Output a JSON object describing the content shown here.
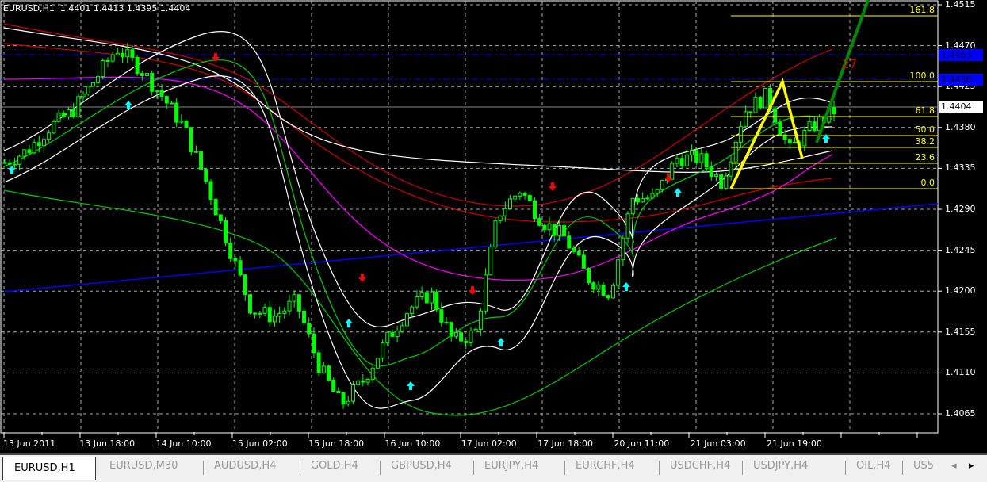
{
  "header": {
    "symbol": "EURUSD,H1",
    "ohlc": "1.4401 1.4413 1.4395 1.4404"
  },
  "price_axis": [
    "1.4515",
    "1.4470",
    "1.4425",
    "1.4380",
    "1.4335",
    "1.4290",
    "1.4245",
    "1.4200",
    "1.4155",
    "1.4110",
    "1.4065"
  ],
  "price_boxes": {
    "line1": "1.4463",
    "line2": "1.4436",
    "current": "1.4404"
  },
  "fib_levels": [
    "161.8",
    "100.0",
    "61.8",
    "50.0",
    "38.2",
    "23.6",
    "0.0"
  ],
  "wave_label": "27",
  "time_axis": [
    "13 Jun 2011",
    "13 Jun 18:00",
    "14 Jun 10:00",
    "15 Jun 02:00",
    "15 Jun 18:00",
    "16 Jun 10:00",
    "17 Jun 02:00",
    "17 Jun 18:00",
    "20 Jun 11:00",
    "21 Jun 03:00",
    "21 Jun 19:00"
  ],
  "tabs": [
    "EURUSD,H1",
    "EURUSD,M30",
    "AUDUSD,H4",
    "GOLD,H4",
    "GBPUSD,H4",
    "EURJPY,H4",
    "EURCHF,H4",
    "USDCHF,H4",
    "USDJPY,H4",
    "OIL,H4",
    "US5"
  ],
  "colors": {
    "bull": "#00ff00",
    "bear": "#000000",
    "fib": "#ffff00",
    "trend": "#0000ff",
    "accent": "#0000ff"
  },
  "price_path": [
    1.4341,
    1.4354,
    1.438,
    1.4397,
    1.4432,
    1.4467,
    1.4446,
    1.4415,
    1.438,
    1.4319,
    1.4249,
    1.4179,
    1.4171,
    1.4188,
    1.4118,
    1.4074,
    1.4101,
    1.4144,
    1.4179,
    1.4197,
    1.4144,
    1.4153,
    1.4284,
    1.4311,
    1.4276,
    1.4258,
    1.4214,
    1.4197,
    1.4302,
    1.4302,
    1.4346,
    1.4346,
    1.4319,
    1.4398,
    1.4415,
    1.4354,
    1.438,
    1.4398
  ]
}
